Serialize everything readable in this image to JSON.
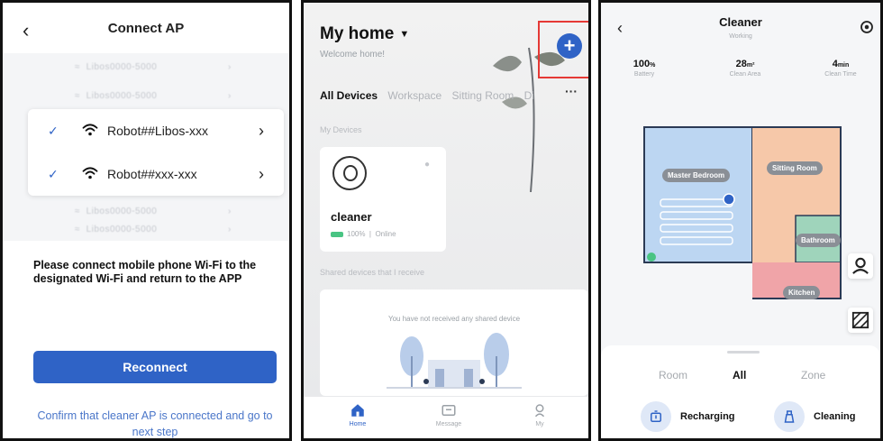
{
  "panel1": {
    "title": "Connect AP",
    "back_icon": "chevron-left-icon",
    "blurred_networks": [
      "Libos0000-5000",
      "Libos0000-5000",
      "Libos0000-5000",
      "Libos0000-5000"
    ],
    "networks": [
      {
        "ssid": "Robot##Libos-xxx",
        "checked": true
      },
      {
        "ssid": "Robot##xxx-xxx",
        "checked": true
      }
    ],
    "message": "Please connect mobile phone Wi-Fi to the designated Wi-Fi and return to the APP",
    "reconnect_label": "Reconnect",
    "confirm_text": "Confirm that cleaner AP is connected and go to next step",
    "accent": "#2f63c6"
  },
  "panel2": {
    "title": "My home",
    "welcome": "Welcome home!",
    "tabs": [
      "All Devices",
      "Workspace",
      "Sitting Room",
      "Di"
    ],
    "more_label": "···",
    "my_devices_label": "My Devices",
    "device": {
      "name": "cleaner",
      "battery": "100%",
      "status": "Online"
    },
    "shared_label": "Shared devices that I receive",
    "shared_empty": "You have not received any shared device",
    "nav": [
      {
        "label": "Home",
        "icon": "home-icon",
        "active": true
      },
      {
        "label": "Message",
        "icon": "message-icon",
        "active": false
      },
      {
        "label": "My",
        "icon": "profile-icon",
        "active": false
      }
    ],
    "highlight_color": "#e53935"
  },
  "panel3": {
    "title": "Cleaner",
    "subtitle": "Working",
    "stats": [
      {
        "value": "100",
        "unit": "%",
        "label": "Battery"
      },
      {
        "value": "28",
        "unit": "m²",
        "label": "Clean Area"
      },
      {
        "value": "4",
        "unit": "min",
        "label": "Clean Time"
      }
    ],
    "rooms": [
      "Master Bedroom",
      "Sitting Room",
      "Bathroom",
      "Kitchen"
    ],
    "modes": [
      "Room",
      "All",
      "Zone"
    ],
    "active_mode": "All",
    "actions": [
      {
        "label": "Recharging",
        "icon": "recharge-icon"
      },
      {
        "label": "Cleaning",
        "icon": "cleaning-icon"
      }
    ],
    "room_colors": {
      "bedroom": "#bcd6f2",
      "sitting": "#f6c8a9",
      "bathroom": "#9fd4bb",
      "kitchen": "#f0a4a8"
    }
  }
}
